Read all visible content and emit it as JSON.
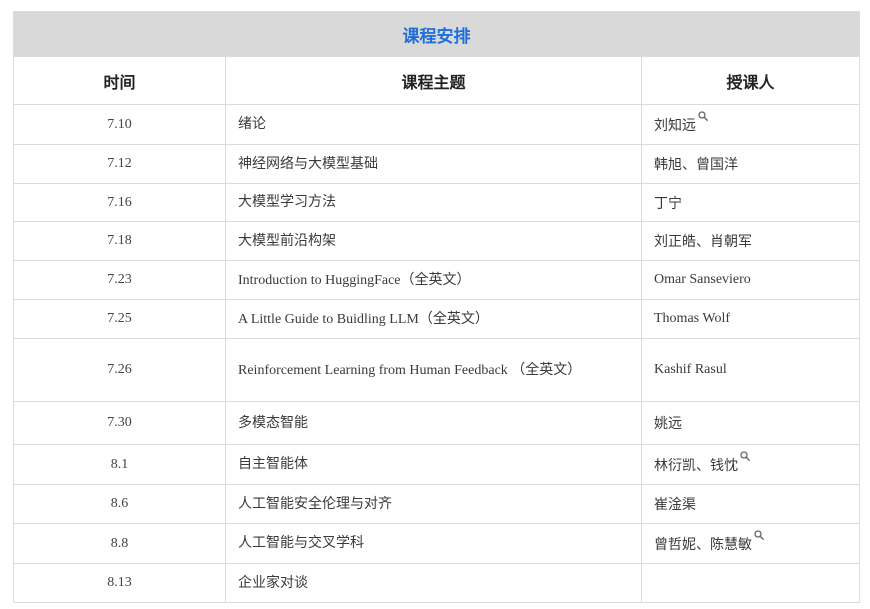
{
  "table": {
    "caption": "课程安排",
    "headers": {
      "date": "时间",
      "topic": "课程主题",
      "teacher": "授课人"
    },
    "rows": [
      {
        "date": "7.10",
        "topic": "绪论",
        "teacher": "刘知远",
        "search": true
      },
      {
        "date": "7.12",
        "topic": "神经网络与大模型基础",
        "teacher": "韩旭、曾国洋",
        "search": false
      },
      {
        "date": "7.16",
        "topic": "大模型学习方法",
        "teacher": "丁宁",
        "search": false
      },
      {
        "date": "7.18",
        "topic": "大模型前沿构架",
        "teacher": "刘正皓、肖朝军",
        "search": false
      },
      {
        "date": "7.23",
        "topic": "Introduction to HuggingFace（全英文）",
        "teacher": "Omar Sanseviero",
        "search": false
      },
      {
        "date": "7.25",
        "topic": "A Little Guide to Buidling LLM（全英文）",
        "teacher": "Thomas Wolf",
        "search": false
      },
      {
        "date": "7.26",
        "topic": "Reinforcement Learning from Human Feedback （全英文）",
        "teacher": "Kashif Rasul",
        "search": false
      },
      {
        "date": "7.30",
        "topic": "多模态智能",
        "teacher": "姚远",
        "search": false
      },
      {
        "date": "8.1",
        "topic": "自主智能体",
        "teacher": "林衍凯、钱忱",
        "search": true
      },
      {
        "date": "8.6",
        "topic": "人工智能安全伦理与对齐",
        "teacher": "崔淦渠",
        "search": false
      },
      {
        "date": "8.8",
        "topic": "人工智能与交叉学科",
        "teacher": "曾哲妮、陈慧敏",
        "search": true
      },
      {
        "date": "8.13",
        "topic": "企业家对谈",
        "teacher": "",
        "search": false
      }
    ]
  },
  "icons": {
    "search": "search-icon"
  },
  "colors": {
    "caption_text": "#1e6fd9",
    "caption_bg": "#d9d9d9",
    "border": "#dcdcdc"
  }
}
